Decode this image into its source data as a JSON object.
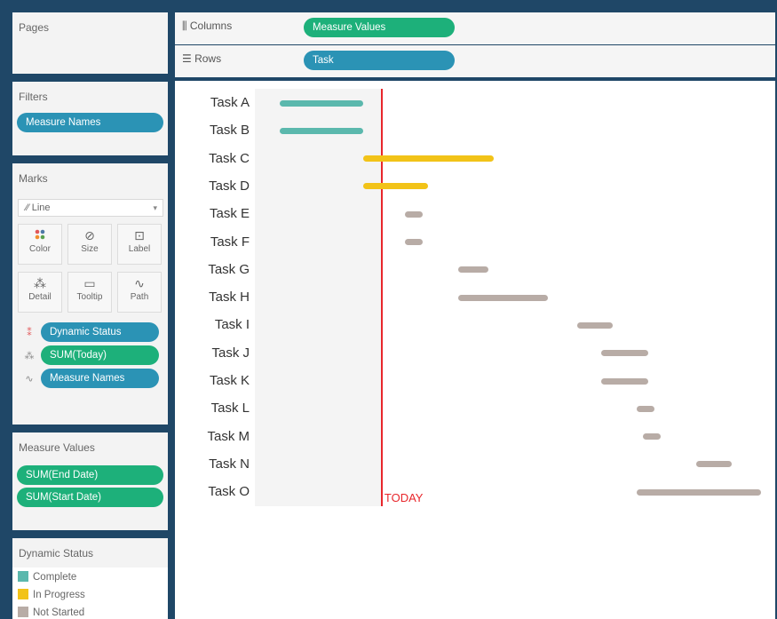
{
  "pages": {
    "title": "Pages"
  },
  "filters": {
    "title": "Filters",
    "pill": "Measure Names"
  },
  "marks": {
    "title": "Marks",
    "type": "Line",
    "buttons": [
      {
        "label": "Color",
        "icon": "color-icon"
      },
      {
        "label": "Size",
        "icon": "size-icon"
      },
      {
        "label": "Label",
        "icon": "label-icon"
      },
      {
        "label": "Detail",
        "icon": "detail-icon"
      },
      {
        "label": "Tooltip",
        "icon": "tooltip-icon"
      },
      {
        "label": "Path",
        "icon": "path-icon"
      }
    ],
    "fields": [
      {
        "label": "Dynamic Status",
        "icon": "color-icon",
        "color": "#2b93b5"
      },
      {
        "label": "SUM(Today)",
        "icon": "detail-icon",
        "color": "#1db07a"
      },
      {
        "label": "Measure Names",
        "icon": "path-icon",
        "color": "#2b93b5"
      }
    ]
  },
  "measure_values": {
    "title": "Measure Values",
    "pills": [
      "SUM(End Date)",
      "SUM(Start Date)"
    ]
  },
  "legend": {
    "title": "Dynamic Status",
    "items": [
      {
        "label": "Complete",
        "color": "#5bb8ad"
      },
      {
        "label": "In Progress",
        "color": "#f2c318"
      },
      {
        "label": "Not Started",
        "color": "#b8aca6"
      }
    ]
  },
  "shelves": {
    "columns_label": "Columns",
    "columns_pill": "Measure Values",
    "rows_label": "Rows",
    "rows_pill": "Task"
  },
  "chart_data": {
    "type": "gantt",
    "today_label": "TODAY",
    "today": 17,
    "x_range": [
      -5,
      78
    ],
    "tasks": [
      {
        "name": "Task A",
        "start": 0,
        "end": 14,
        "status": "Complete"
      },
      {
        "name": "Task B",
        "start": 0,
        "end": 14,
        "status": "Complete"
      },
      {
        "name": "Task C",
        "start": 14,
        "end": 36,
        "status": "In Progress"
      },
      {
        "name": "Task D",
        "start": 14,
        "end": 25,
        "status": "In Progress"
      },
      {
        "name": "Task E",
        "start": 21,
        "end": 24,
        "status": "Not Started"
      },
      {
        "name": "Task F",
        "start": 21,
        "end": 24,
        "status": "Not Started"
      },
      {
        "name": "Task G",
        "start": 30,
        "end": 35,
        "status": "Not Started"
      },
      {
        "name": "Task H",
        "start": 30,
        "end": 45,
        "status": "Not Started"
      },
      {
        "name": "Task I",
        "start": 50,
        "end": 56,
        "status": "Not Started"
      },
      {
        "name": "Task J",
        "start": 54,
        "end": 62,
        "status": "Not Started"
      },
      {
        "name": "Task K",
        "start": 54,
        "end": 62,
        "status": "Not Started"
      },
      {
        "name": "Task L",
        "start": 60,
        "end": 63,
        "status": "Not Started"
      },
      {
        "name": "Task M",
        "start": 61,
        "end": 64,
        "status": "Not Started"
      },
      {
        "name": "Task N",
        "start": 70,
        "end": 76,
        "status": "Not Started"
      },
      {
        "name": "Task O",
        "start": 60,
        "end": 81,
        "status": "Not Started"
      }
    ]
  }
}
